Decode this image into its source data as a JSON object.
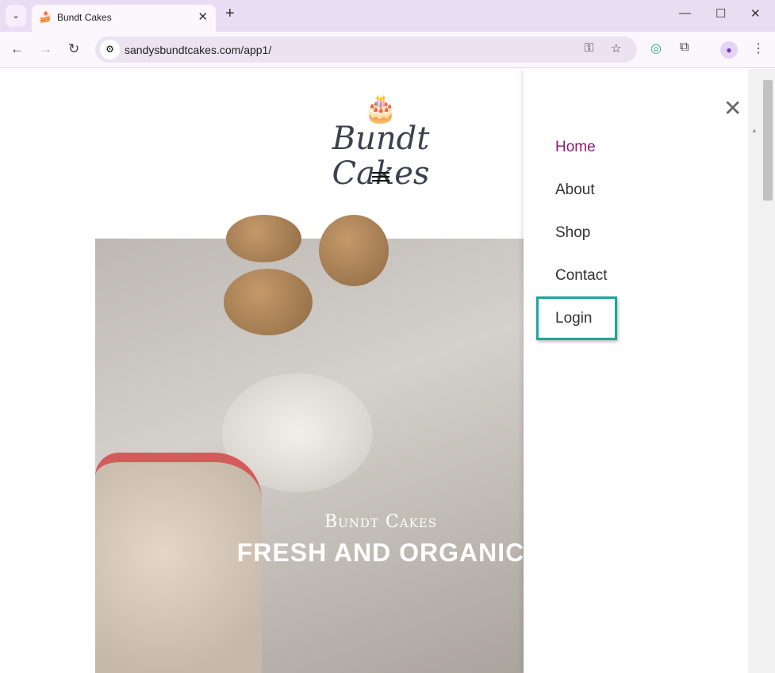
{
  "browser": {
    "tab_title": "Bundt Cakes",
    "url": "sandysbundtcakes.com/app1/"
  },
  "site": {
    "logo_text": "Bundt Cakes",
    "hero_subtitle": "Bundt Cakes",
    "hero_title": "FRESH AND ORGANIC"
  },
  "menu": {
    "items": [
      {
        "label": "Home",
        "color": "#8b1a7a"
      },
      {
        "label": "About"
      },
      {
        "label": "Shop"
      },
      {
        "label": "Contact"
      },
      {
        "label": "Login"
      }
    ]
  },
  "colors": {
    "highlight": "#19a89a"
  }
}
